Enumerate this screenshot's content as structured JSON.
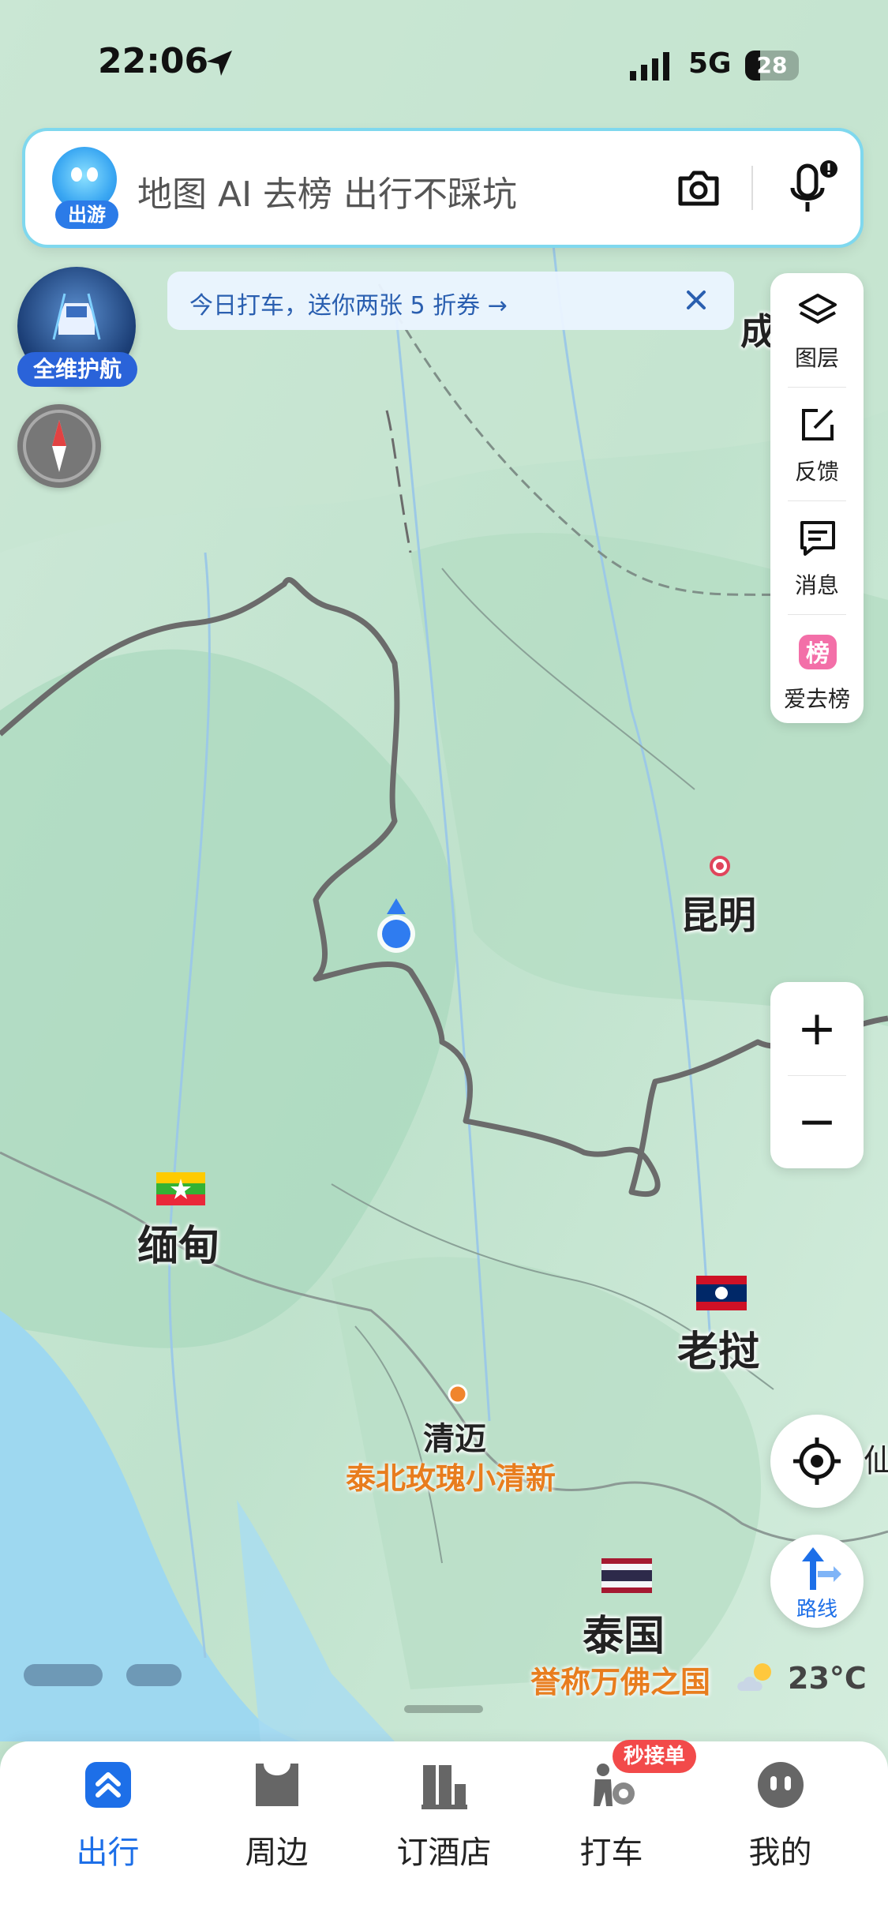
{
  "status_bar": {
    "time": "22:06",
    "network": "5G",
    "battery": "28",
    "battery_level": 0.28
  },
  "search": {
    "badge": "出游",
    "placeholder_text": "地图 AI 去榜 出行不踩坑"
  },
  "promo": {
    "text": "今日打车，送你两张 5 折券 →"
  },
  "left_controls": {
    "car_badge": "全维护航"
  },
  "right_panel": {
    "items": [
      {
        "label": "图层",
        "icon": "layers-icon"
      },
      {
        "label": "反馈",
        "icon": "feedback-icon"
      },
      {
        "label": "消息",
        "icon": "message-icon"
      },
      {
        "label": "爱去榜",
        "icon": "ranking-icon"
      }
    ]
  },
  "zoom": {
    "in": "+",
    "out": "−"
  },
  "route": {
    "label": "路线"
  },
  "map_labels": {
    "kunming": "昆明",
    "myanmar": "缅甸",
    "laos": "老挝",
    "chiangmai": "清迈",
    "chiangmai_tag": "泰北玫瑰小清新",
    "thailand": "泰国",
    "thailand_tag": "誉称万佛之国",
    "cheng_partial": "成",
    "edge_partial": "仙"
  },
  "weather": {
    "temp": "23°C",
    "icon": "partly-cloudy-icon"
  },
  "tabbar": {
    "tabs": [
      {
        "label": "出行",
        "active": true
      },
      {
        "label": "周边",
        "active": false
      },
      {
        "label": "订酒店",
        "active": false
      },
      {
        "label": "打车",
        "active": false
      },
      {
        "label": "我的",
        "active": false
      }
    ],
    "taxi_badge": "秒接单"
  },
  "colors": {
    "accent": "#1d6fe8",
    "map_base": "#d9efe3",
    "border": "#6b6b6b",
    "orange": "#e87d1e",
    "badge_red": "#f24a4a"
  }
}
